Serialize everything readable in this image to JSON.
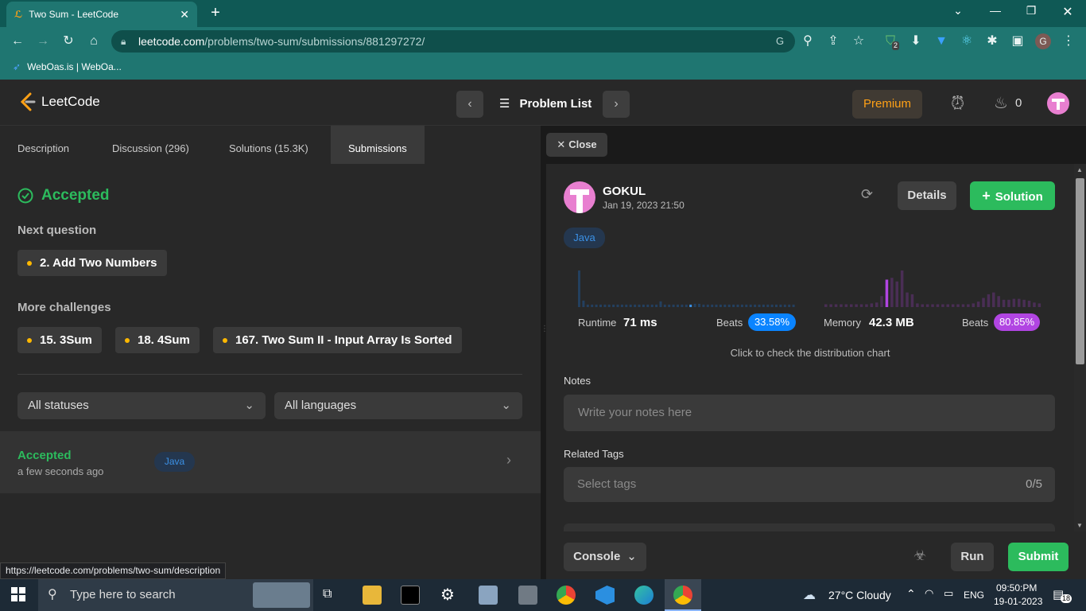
{
  "browser": {
    "tab_title": "Two Sum - LeetCode",
    "url_domain": "leetcode.com",
    "url_path": "/problems/two-sum/submissions/881297272/",
    "bookmark": "WebOas.is | WebOa...",
    "extension_badge": "2",
    "profile_initial": "G",
    "status_url": "https://leetcode.com/problems/two-sum/description"
  },
  "nav": {
    "logo_text": "LeetCode",
    "problem_list": "Problem List",
    "premium": "Premium",
    "streak_count": "0"
  },
  "left_tabs": [
    {
      "label": "Description"
    },
    {
      "label": "Discussion (296)"
    },
    {
      "label": "Solutions (15.3K)"
    },
    {
      "label": "Submissions"
    }
  ],
  "left": {
    "status": "Accepted",
    "next_question_label": "Next question",
    "next_question": "2. Add Two Numbers",
    "more_challenges_label": "More challenges",
    "challenges": [
      "15. 3Sum",
      "18. 4Sum",
      "167. Two Sum II - Input Array Is Sorted"
    ],
    "status_filter": "All statuses",
    "language_filter": "All languages",
    "submission": {
      "status": "Accepted",
      "time": "a few seconds ago",
      "language": "Java"
    }
  },
  "right": {
    "close": "Close",
    "user": "GOKUL",
    "date": "Jan 19, 2023 21:50",
    "details": "Details",
    "solution": "Solution",
    "language": "Java",
    "runtime_label": "Runtime",
    "runtime": "71 ms",
    "beats_label": "Beats",
    "runtime_beats": "33.58%",
    "memory_label": "Memory",
    "memory": "42.3 MB",
    "memory_beats": "80.85%",
    "distribution_hint": "Click to check the distribution chart",
    "notes_label": "Notes",
    "notes_placeholder": "Write your notes here",
    "tags_label": "Related Tags",
    "tags_placeholder": "Select tags",
    "tags_count": "0/5",
    "console": "Console",
    "run": "Run",
    "submit": "Submit"
  },
  "taskbar": {
    "search_placeholder": "Type here to search",
    "weather": "27°C  Cloudy",
    "lang": "ENG",
    "time": "09:50:PM",
    "date": "19-01-2023",
    "notification_count": "18"
  },
  "colors": {
    "accent_green": "#2cbb5d",
    "leetcode_orange": "#ffa116",
    "blue_badge": "#0a84ff",
    "purple_badge": "#b145e2"
  },
  "chart_data": [
    {
      "type": "bar",
      "title": "",
      "note": "runtime distribution sparkline (relative heights)",
      "values": [
        45,
        8,
        3,
        3,
        3,
        3,
        3,
        3,
        3,
        3,
        3,
        3,
        3,
        3,
        3,
        3,
        3,
        3,
        3,
        7,
        3,
        3,
        3,
        3,
        3,
        3,
        3,
        4,
        4,
        3,
        3,
        3,
        3,
        3,
        3,
        3,
        3,
        3,
        3,
        3,
        3,
        3,
        3,
        3,
        3,
        3,
        3,
        3,
        3,
        3,
        3
      ],
      "highlight_index": 26
    },
    {
      "type": "bar",
      "title": "",
      "note": "memory distribution sparkline (relative heights)",
      "values": [
        3,
        3,
        3,
        3,
        3,
        3,
        3,
        3,
        3,
        4,
        5,
        12,
        30,
        32,
        28,
        40,
        16,
        14,
        4,
        3,
        3,
        3,
        3,
        3,
        3,
        3,
        3,
        3,
        3,
        4,
        6,
        10,
        14,
        16,
        12,
        8,
        8,
        9,
        9,
        8,
        7,
        5,
        4
      ],
      "highlight_index": 12
    }
  ]
}
